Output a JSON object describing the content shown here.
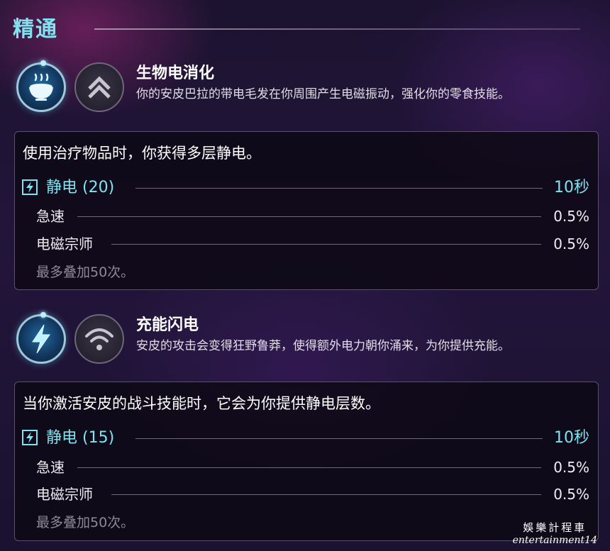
{
  "section_title": "精通",
  "abilities": [
    {
      "name": "生物电消化",
      "description": "你的安皮巴拉的带电毛发在你周围产生电磁振动，强化你的零食技能。",
      "active_icon": "food-bowl-icon",
      "passive_icon": "double-chevron-up-icon",
      "detail": {
        "headline": "使用治疗物品时，你获得多层静电。",
        "main_stat": {
          "label": "静电 (20)",
          "value": "10秒",
          "icon": "lightning-bolt-icon"
        },
        "stats": [
          {
            "label": "急速",
            "value": "0.5%"
          },
          {
            "label": "电磁宗师",
            "value": "0.5%"
          }
        ],
        "note": "最多叠加50次。"
      }
    },
    {
      "name": "充能闪电",
      "description": "安皮的攻击会变得狂野鲁莽，使得额外电力朝你涌来，为你提供充能。",
      "active_icon": "lightning-bolt-icon",
      "passive_icon": "wifi-signal-icon",
      "detail": {
        "headline": "当你激活安皮的战斗技能时，它会为你提供静电层数。",
        "main_stat": {
          "label": "静电 (15)",
          "value": "10秒",
          "icon": "lightning-bolt-icon"
        },
        "stats": [
          {
            "label": "急速",
            "value": "0.5%"
          },
          {
            "label": "电磁宗师",
            "value": "0.5%"
          }
        ],
        "note": "最多叠加50次。"
      }
    }
  ],
  "watermark": {
    "line1": "娛樂計程車",
    "line2": "entertainment14"
  },
  "colors": {
    "accent": "#7fe3f0",
    "panel_bg": "#0c0814",
    "text": "#ffffff",
    "muted": "#8e8996"
  }
}
